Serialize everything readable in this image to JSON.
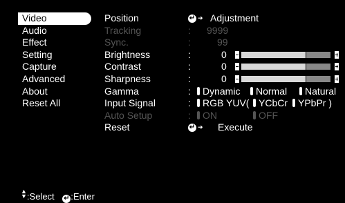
{
  "menu": {
    "items": [
      {
        "label": "Video",
        "selected": true
      },
      {
        "label": "Audio",
        "selected": false
      },
      {
        "label": "Effect",
        "selected": false
      },
      {
        "label": "Setting",
        "selected": false
      },
      {
        "label": "Capture",
        "selected": false
      },
      {
        "label": "Advanced",
        "selected": false
      },
      {
        "label": "About",
        "selected": false
      },
      {
        "label": "Reset All",
        "selected": false
      }
    ]
  },
  "settings": {
    "position": {
      "label": "Position",
      "action": "Adjustment"
    },
    "tracking": {
      "label": "Tracking",
      "value": "9999"
    },
    "sync": {
      "label": "Sync.",
      "value": "99"
    },
    "brightness": {
      "label": "Brightness",
      "value": "0",
      "level": 0.72
    },
    "contrast": {
      "label": "Contrast",
      "value": "0",
      "level": 0.72
    },
    "sharpness": {
      "label": "Sharpness",
      "value": "0",
      "level": 0.72
    },
    "gamma": {
      "label": "Gamma",
      "options": [
        "Dynamic",
        "Normal",
        "Natural"
      ]
    },
    "input_signal": {
      "label": "Input Signal",
      "options": [
        "RGB",
        "YUV(",
        "YCbCr",
        "YPbPr )"
      ]
    },
    "auto_setup": {
      "label": "Auto Setup",
      "options": [
        "ON",
        "OFF"
      ]
    },
    "reset": {
      "label": "Reset",
      "action": "Execute"
    }
  },
  "colon": ":",
  "footer": {
    "select_label": ":Select",
    "enter_label": ":Enter"
  },
  "colors": {
    "background": "#000000",
    "text": "#ffffff",
    "dim": "#555555",
    "slider_fill": "#d8d8d8",
    "slider_empty": "#888888"
  }
}
